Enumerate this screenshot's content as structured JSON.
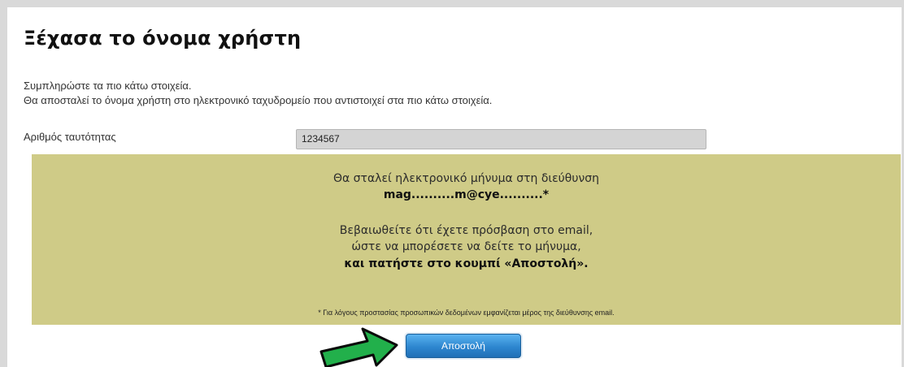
{
  "page": {
    "title": "Ξέχασα το όνομα χρήστη",
    "intro_line1": "Συμπληρώστε τα πιο κάτω στοιχεία.",
    "intro_line2": "Θα αποσταλεί το όνομα χρήστη στο ηλεκτρονικό ταχυδρομείο που αντιστοιχεί στα πιο κάτω στοιχεία."
  },
  "form": {
    "id_label": "Αριθμός ταυτότητας",
    "id_value": "1234567"
  },
  "notice": {
    "line1": "Θα σταλεί ηλεκτρονικό μήνυμα στη διεύθυνση",
    "email_masked": "mag..........m@cye..........*",
    "line3": "Βεβαιωθείτε ότι έχετε πρόσβαση στο email,",
    "line4": "ώστε να μπορέσετε να δείτε το μήνυμα,",
    "line5": "και πατήστε στο κουμπί «Αποστολή».",
    "footnote": "* Για λόγους προστασίας προσωπικών δεδομένων εμφανίζεται μέρος της διεύθυνσης email.",
    "background_color": "#cfcb87"
  },
  "buttons": {
    "send_label": "Αποστολή"
  },
  "annotation": {
    "arrow_icon": "green-arrow-icon",
    "arrow_color": "#22b04b"
  }
}
